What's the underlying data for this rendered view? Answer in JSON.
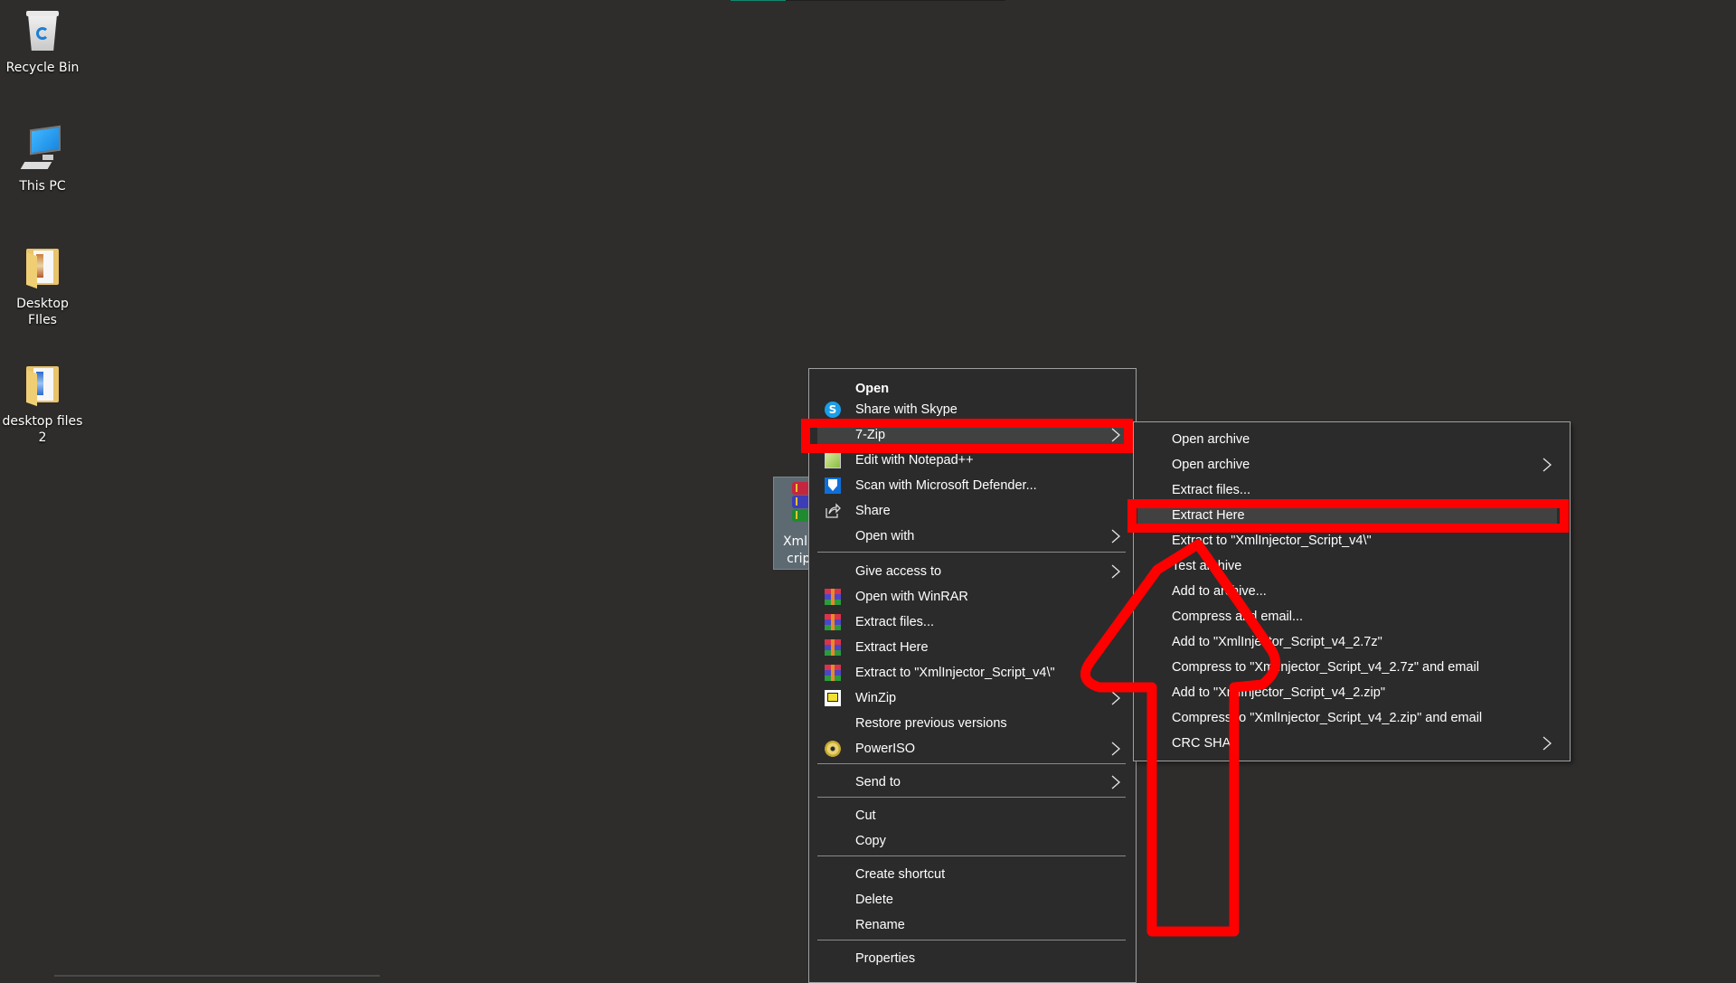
{
  "desktop": {
    "icons": [
      {
        "label": "Recycle Bin",
        "icon": "recycle-bin-icon"
      },
      {
        "label": "This PC",
        "icon": "computer-icon"
      },
      {
        "label": "Desktop FIles",
        "icon": "folder-icon"
      },
      {
        "label": "desktop files 2",
        "icon": "folder-icon"
      }
    ],
    "selected_file": {
      "label": "XmlInjector_Script",
      "label_visible": "XmlIn cript",
      "icon": "winrar-archive-icon"
    }
  },
  "context_menu": {
    "items": [
      {
        "label": "Open",
        "bold": true
      },
      {
        "label": "Share with Skype",
        "icon": "skype-icon"
      },
      {
        "label": "7-Zip",
        "submenu": true,
        "highlighted": true
      },
      {
        "label": "Edit with Notepad++",
        "icon": "notepad-plus-plus-icon"
      },
      {
        "label": "Scan with Microsoft Defender...",
        "icon": "defender-shield-icon"
      },
      {
        "label": "Share",
        "icon": "share-icon"
      },
      {
        "label": "Open with",
        "submenu": true
      },
      {
        "label": "Give access to",
        "submenu": true
      },
      {
        "label": "Open with WinRAR",
        "icon": "winrar-icon"
      },
      {
        "label": "Extract files...",
        "icon": "winrar-icon"
      },
      {
        "label": "Extract Here",
        "icon": "winrar-icon"
      },
      {
        "label": "Extract to \"XmlInjector_Script_v4\\\"",
        "icon": "winrar-icon"
      },
      {
        "label": "WinZip",
        "icon": "winzip-icon",
        "submenu": true
      },
      {
        "label": "Restore previous versions"
      },
      {
        "label": "PowerISO",
        "icon": "poweriso-icon",
        "submenu": true
      },
      {
        "label": "Send to",
        "submenu": true
      },
      {
        "label": "Cut"
      },
      {
        "label": "Copy"
      },
      {
        "label": "Create shortcut"
      },
      {
        "label": "Delete"
      },
      {
        "label": "Rename"
      },
      {
        "label": "Properties"
      }
    ]
  },
  "zip_submenu": {
    "items": [
      {
        "label": "Open archive"
      },
      {
        "label": "Open archive",
        "submenu": true
      },
      {
        "label": "Extract files..."
      },
      {
        "label": "Extract Here",
        "highlighted": true
      },
      {
        "label": "Extract to \"XmlInjector_Script_v4\\\""
      },
      {
        "label": "Test archive"
      },
      {
        "label": "Add to archive..."
      },
      {
        "label": "Compress and email..."
      },
      {
        "label": "Add to \"XmlInjector_Script_v4_2.7z\""
      },
      {
        "label": "Compress to \"XmlInjector_Script_v4_2.7z\" and email"
      },
      {
        "label": "Add to \"XmlInjector_Script_v4_2.zip\""
      },
      {
        "label": "Compress to \"XmlInjector_Script_v4_2.zip\" and email"
      },
      {
        "label": "CRC SHA",
        "submenu": true
      }
    ]
  },
  "annotations": {
    "color": "#ff0000",
    "highlight_boxes": [
      "7-Zip",
      "Extract Here"
    ],
    "arrow": "up-arrow pointing to Extract Here"
  },
  "colors": {
    "desktop_bg": "#2e2d2b",
    "menu_bg": "#2b2b2b",
    "menu_highlight": "#414141",
    "menu_border": "#a0a0a0",
    "annotation_red": "#ff0000"
  }
}
